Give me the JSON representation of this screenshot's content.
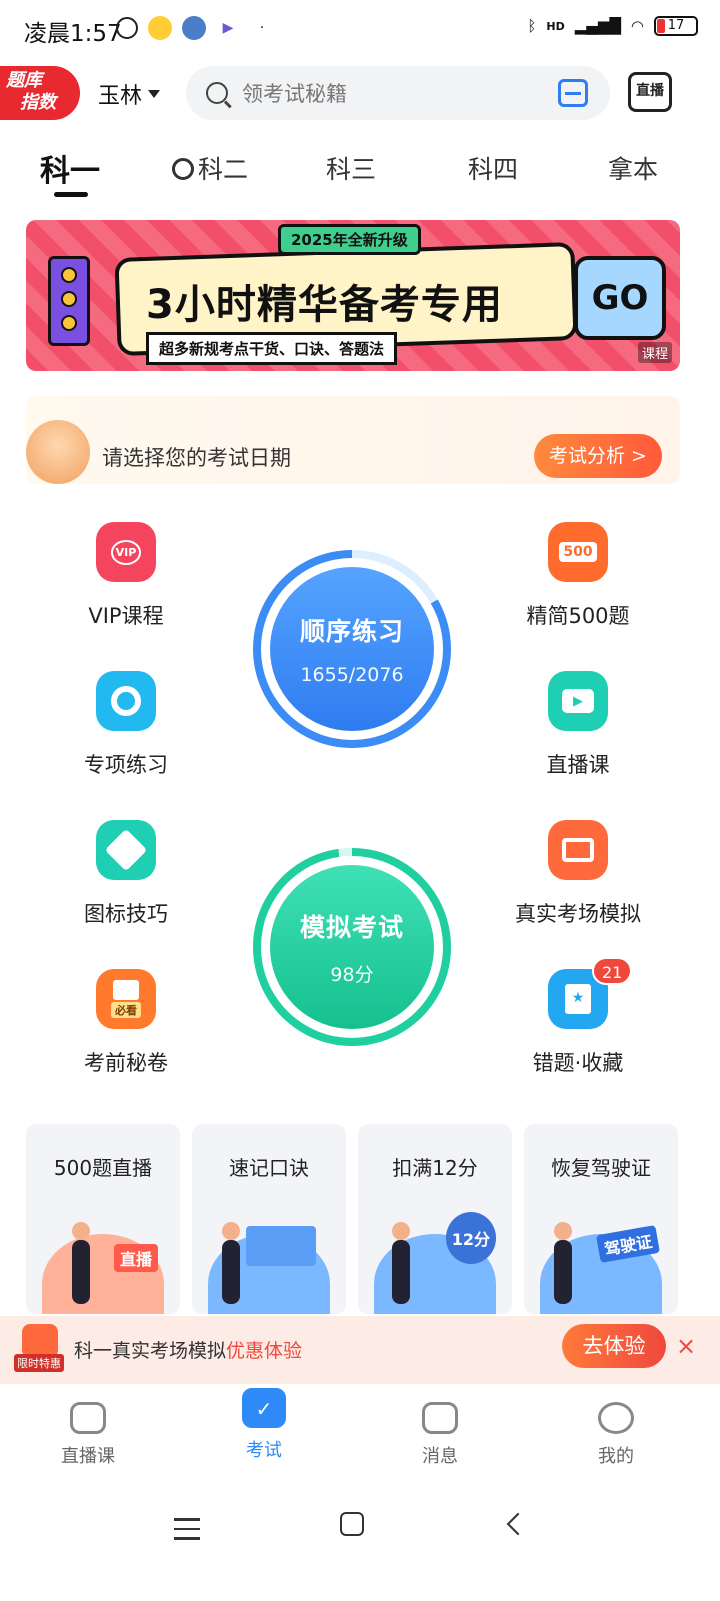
{
  "status_bar": {
    "time": "凌晨1:57",
    "battery": "17",
    "signal_label": "HD"
  },
  "header": {
    "logo_line1": "题库",
    "logo_line2": "指数",
    "city": "玉林",
    "search_placeholder": "领考试秘籍",
    "live_button": "直播"
  },
  "tabs": [
    {
      "label": "科一",
      "active": true
    },
    {
      "label": "科二",
      "active": false
    },
    {
      "label": "科三",
      "active": false
    },
    {
      "label": "科四",
      "active": false
    },
    {
      "label": "拿本",
      "active": false
    }
  ],
  "banner": {
    "tag": "2025年全新升级",
    "title": "3小时精华备考专用",
    "subtitle": "超多新规考点干货、口诀、答题法",
    "go": "GO",
    "corner": "课程"
  },
  "exam_date": {
    "prompt": "请选择您的考试日期",
    "button": "考试分析 >"
  },
  "left_items": [
    {
      "label": "VIP课程",
      "icon": "vip-icon",
      "color": "#f5455e"
    },
    {
      "label": "专项练习",
      "icon": "target-icon",
      "color": "#22b8f0"
    },
    {
      "label": "图标技巧",
      "icon": "road-sign-icon",
      "color": "#1fcfb4"
    },
    {
      "label": "考前秘卷",
      "icon": "exam-paper-icon",
      "color": "#ff7a2d",
      "sub": "必看"
    }
  ],
  "right_items": [
    {
      "label": "精简500题",
      "icon": "500-icon",
      "color": "#ff6a2d",
      "glyph": "500"
    },
    {
      "label": "直播课",
      "icon": "video-icon",
      "color": "#1fcfb4"
    },
    {
      "label": "真实考场模拟",
      "icon": "monitor-icon",
      "color": "#ff6a3d"
    },
    {
      "label": "错题·收藏",
      "icon": "bookmark-icon",
      "color": "#22a7f0",
      "badge": "21"
    }
  ],
  "practice": {
    "title": "顺序练习",
    "progress": "1655/2076",
    "color": "#3c8cf5"
  },
  "mock_exam": {
    "title": "模拟考试",
    "score": "98分",
    "color": "#1fcf9f"
  },
  "cards": [
    {
      "title": "500题直播",
      "mini": "直播",
      "color": "#ffb199"
    },
    {
      "title": "速记口诀",
      "mini": "",
      "color": "#7cb8ff"
    },
    {
      "title": "扣满12分",
      "mini": "12分",
      "color": "#7cb8ff"
    },
    {
      "title": "恢复驾驶证",
      "mini": "驾驶证",
      "color": "#7cb8ff"
    }
  ],
  "promo": {
    "badge": "限时特惠",
    "text": "科一真实考场模拟",
    "highlight": "优惠体验",
    "button": "去体验",
    "close": "×"
  },
  "bottom_nav": [
    {
      "label": "直播课",
      "icon": "live-tv-icon",
      "active": false
    },
    {
      "label": "考试",
      "icon": "exam-folder-icon",
      "active": true
    },
    {
      "label": "消息",
      "icon": "message-icon",
      "active": false
    },
    {
      "label": "我的",
      "icon": "profile-icon",
      "active": false
    }
  ]
}
